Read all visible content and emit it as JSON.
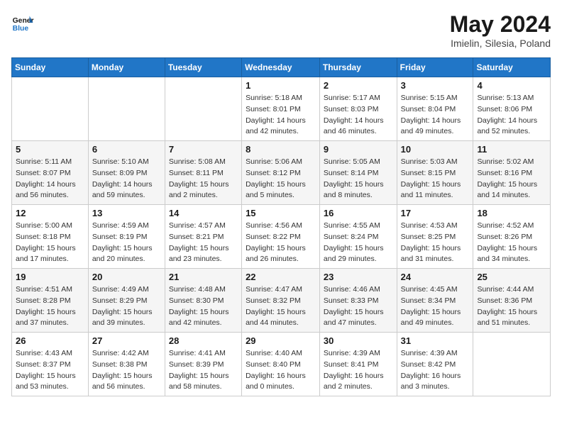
{
  "header": {
    "logo_general": "General",
    "logo_blue": "Blue",
    "month": "May 2024",
    "location": "Imielin, Silesia, Poland"
  },
  "days_of_week": [
    "Sunday",
    "Monday",
    "Tuesday",
    "Wednesday",
    "Thursday",
    "Friday",
    "Saturday"
  ],
  "weeks": [
    [
      {
        "day": "",
        "sunrise": "",
        "sunset": "",
        "daylight": ""
      },
      {
        "day": "",
        "sunrise": "",
        "sunset": "",
        "daylight": ""
      },
      {
        "day": "",
        "sunrise": "",
        "sunset": "",
        "daylight": ""
      },
      {
        "day": "1",
        "sunrise": "5:18 AM",
        "sunset": "8:01 PM",
        "daylight": "14 hours and 42 minutes."
      },
      {
        "day": "2",
        "sunrise": "5:17 AM",
        "sunset": "8:03 PM",
        "daylight": "14 hours and 46 minutes."
      },
      {
        "day": "3",
        "sunrise": "5:15 AM",
        "sunset": "8:04 PM",
        "daylight": "14 hours and 49 minutes."
      },
      {
        "day": "4",
        "sunrise": "5:13 AM",
        "sunset": "8:06 PM",
        "daylight": "14 hours and 52 minutes."
      }
    ],
    [
      {
        "day": "5",
        "sunrise": "5:11 AM",
        "sunset": "8:07 PM",
        "daylight": "14 hours and 56 minutes."
      },
      {
        "day": "6",
        "sunrise": "5:10 AM",
        "sunset": "8:09 PM",
        "daylight": "14 hours and 59 minutes."
      },
      {
        "day": "7",
        "sunrise": "5:08 AM",
        "sunset": "8:11 PM",
        "daylight": "15 hours and 2 minutes."
      },
      {
        "day": "8",
        "sunrise": "5:06 AM",
        "sunset": "8:12 PM",
        "daylight": "15 hours and 5 minutes."
      },
      {
        "day": "9",
        "sunrise": "5:05 AM",
        "sunset": "8:14 PM",
        "daylight": "15 hours and 8 minutes."
      },
      {
        "day": "10",
        "sunrise": "5:03 AM",
        "sunset": "8:15 PM",
        "daylight": "15 hours and 11 minutes."
      },
      {
        "day": "11",
        "sunrise": "5:02 AM",
        "sunset": "8:16 PM",
        "daylight": "15 hours and 14 minutes."
      }
    ],
    [
      {
        "day": "12",
        "sunrise": "5:00 AM",
        "sunset": "8:18 PM",
        "daylight": "15 hours and 17 minutes."
      },
      {
        "day": "13",
        "sunrise": "4:59 AM",
        "sunset": "8:19 PM",
        "daylight": "15 hours and 20 minutes."
      },
      {
        "day": "14",
        "sunrise": "4:57 AM",
        "sunset": "8:21 PM",
        "daylight": "15 hours and 23 minutes."
      },
      {
        "day": "15",
        "sunrise": "4:56 AM",
        "sunset": "8:22 PM",
        "daylight": "15 hours and 26 minutes."
      },
      {
        "day": "16",
        "sunrise": "4:55 AM",
        "sunset": "8:24 PM",
        "daylight": "15 hours and 29 minutes."
      },
      {
        "day": "17",
        "sunrise": "4:53 AM",
        "sunset": "8:25 PM",
        "daylight": "15 hours and 31 minutes."
      },
      {
        "day": "18",
        "sunrise": "4:52 AM",
        "sunset": "8:26 PM",
        "daylight": "15 hours and 34 minutes."
      }
    ],
    [
      {
        "day": "19",
        "sunrise": "4:51 AM",
        "sunset": "8:28 PM",
        "daylight": "15 hours and 37 minutes."
      },
      {
        "day": "20",
        "sunrise": "4:49 AM",
        "sunset": "8:29 PM",
        "daylight": "15 hours and 39 minutes."
      },
      {
        "day": "21",
        "sunrise": "4:48 AM",
        "sunset": "8:30 PM",
        "daylight": "15 hours and 42 minutes."
      },
      {
        "day": "22",
        "sunrise": "4:47 AM",
        "sunset": "8:32 PM",
        "daylight": "15 hours and 44 minutes."
      },
      {
        "day": "23",
        "sunrise": "4:46 AM",
        "sunset": "8:33 PM",
        "daylight": "15 hours and 47 minutes."
      },
      {
        "day": "24",
        "sunrise": "4:45 AM",
        "sunset": "8:34 PM",
        "daylight": "15 hours and 49 minutes."
      },
      {
        "day": "25",
        "sunrise": "4:44 AM",
        "sunset": "8:36 PM",
        "daylight": "15 hours and 51 minutes."
      }
    ],
    [
      {
        "day": "26",
        "sunrise": "4:43 AM",
        "sunset": "8:37 PM",
        "daylight": "15 hours and 53 minutes."
      },
      {
        "day": "27",
        "sunrise": "4:42 AM",
        "sunset": "8:38 PM",
        "daylight": "15 hours and 56 minutes."
      },
      {
        "day": "28",
        "sunrise": "4:41 AM",
        "sunset": "8:39 PM",
        "daylight": "15 hours and 58 minutes."
      },
      {
        "day": "29",
        "sunrise": "4:40 AM",
        "sunset": "8:40 PM",
        "daylight": "16 hours and 0 minutes."
      },
      {
        "day": "30",
        "sunrise": "4:39 AM",
        "sunset": "8:41 PM",
        "daylight": "16 hours and 2 minutes."
      },
      {
        "day": "31",
        "sunrise": "4:39 AM",
        "sunset": "8:42 PM",
        "daylight": "16 hours and 3 minutes."
      },
      {
        "day": "",
        "sunrise": "",
        "sunset": "",
        "daylight": ""
      }
    ]
  ],
  "labels": {
    "sunrise": "Sunrise:",
    "sunset": "Sunset:",
    "daylight": "Daylight:"
  }
}
